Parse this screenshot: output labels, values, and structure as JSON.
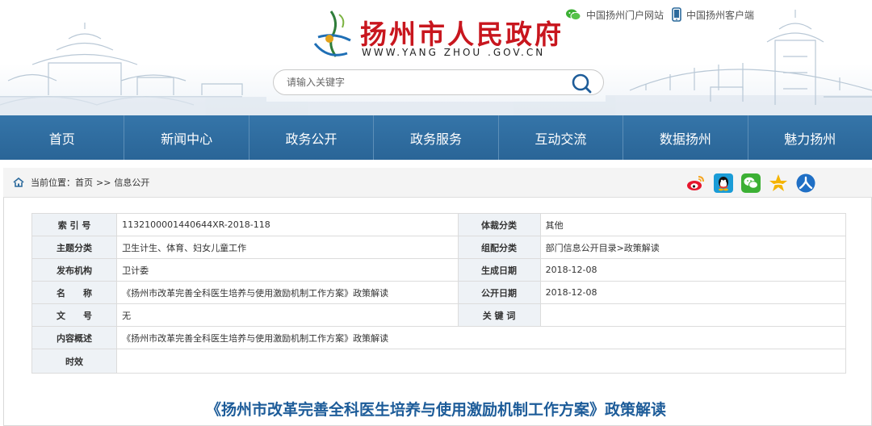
{
  "header": {
    "site_title": "扬州市人民政府",
    "site_url": "WWW.YANG ZHOU .GOV.CN",
    "top_links": [
      {
        "label": "中国扬州门户网站",
        "icon": "wechat-icon"
      },
      {
        "label": "中国扬州客户端",
        "icon": "mobile-phone-icon"
      }
    ],
    "search": {
      "placeholder": "请输入关键字",
      "value": ""
    }
  },
  "nav": {
    "items": [
      "首页",
      "新闻中心",
      "政务公开",
      "政务服务",
      "互动交流",
      "数据扬州",
      "魅力扬州"
    ]
  },
  "breadcrumb": {
    "prefix": "当前位置：",
    "items": [
      "首页",
      "信息公开"
    ],
    "separator": ">>"
  },
  "share_icons": [
    "weibo-icon",
    "qq-icon",
    "wechat-share-icon",
    "qzone-star-icon",
    "renren-icon"
  ],
  "info_table": {
    "rows": [
      {
        "l1": "索 引 号",
        "v1": "1132100001440644XR-2018-118",
        "l2": "体裁分类",
        "v2": "其他"
      },
      {
        "l1": "主题分类",
        "v1": "卫生计生、体育、妇女儿童工作",
        "l2": "组配分类",
        "v2": "部门信息公开目录>政策解读"
      },
      {
        "l1": "发布机构",
        "v1": "卫计委",
        "l2": "生成日期",
        "v2": "2018-12-08"
      },
      {
        "l1": "名　　称",
        "v1": "《扬州市改革完善全科医生培养与使用激励机制工作方案》政策解读",
        "l2": "公开日期",
        "v2": "2018-12-08"
      },
      {
        "l1": "文　　号",
        "v1": "无",
        "l2": "关 键 词",
        "v2": ""
      }
    ],
    "summary_label": "内容概述",
    "summary_value": "《扬州市改革完善全科医生培养与使用激励机制工作方案》政策解读",
    "validity_label": "时效",
    "validity_value": ""
  },
  "document": {
    "title": "《扬州市改革完善全科医生培养与使用激励机制工作方案》政策解读"
  },
  "colors": {
    "brand_red": "#c8161e",
    "nav_blue": "#2c6a9c",
    "title_blue": "#1d5c99"
  }
}
